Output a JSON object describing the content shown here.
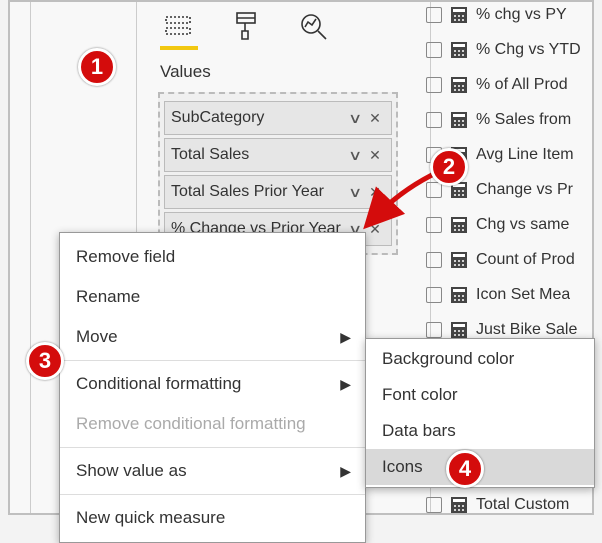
{
  "panel": {
    "values_label": "Values"
  },
  "values": [
    {
      "label": "SubCategory"
    },
    {
      "label": "Total Sales"
    },
    {
      "label": "Total Sales Prior Year"
    },
    {
      "label": "% Change vs Prior Year"
    }
  ],
  "fields": [
    {
      "label": "% chg vs PY"
    },
    {
      "label": "% Chg vs YTD"
    },
    {
      "label": "% of All Prod"
    },
    {
      "label": "% Sales from"
    },
    {
      "label": "Avg Line Item"
    },
    {
      "label": "Change vs Pr"
    },
    {
      "label": "Chg vs same"
    },
    {
      "label": "Count of Prod"
    },
    {
      "label": "Icon Set Mea"
    },
    {
      "label": "Just Bike Sale"
    },
    {
      "label": ""
    },
    {
      "label": ""
    },
    {
      "label": ""
    },
    {
      "label": ""
    },
    {
      "label": "Total Custom"
    }
  ],
  "menu": {
    "remove_field": "Remove field",
    "rename": "Rename",
    "move": "Move",
    "conditional_formatting": "Conditional formatting",
    "remove_cf": "Remove conditional formatting",
    "show_value_as": "Show value as",
    "new_quick_measure": "New quick measure"
  },
  "submenu": {
    "background_color": "Background color",
    "font_color": "Font color",
    "data_bars": "Data bars",
    "icons": "Icons"
  },
  "badges": {
    "b1": "1",
    "b2": "2",
    "b3": "3",
    "b4": "4"
  }
}
